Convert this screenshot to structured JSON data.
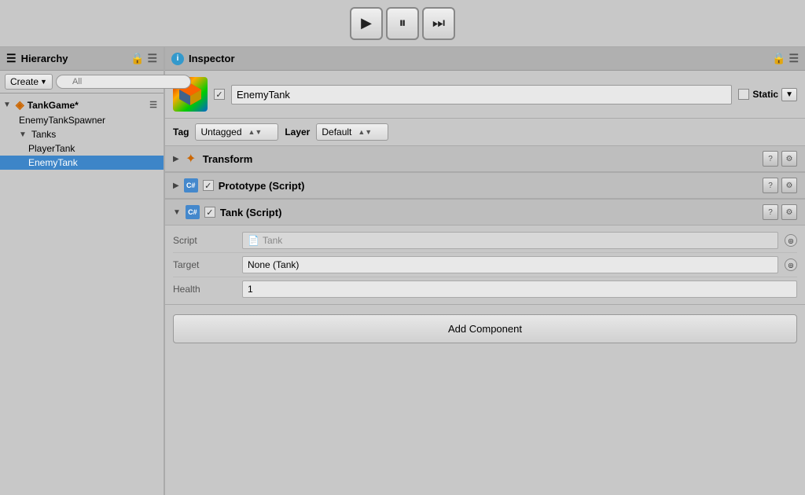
{
  "toolbar": {
    "play_label": "▶",
    "pause_label": "⏸",
    "step_label": "⏭"
  },
  "hierarchy": {
    "title": "Hierarchy",
    "create_label": "Create",
    "search_placeholder": "All",
    "items": [
      {
        "id": "tankgame",
        "label": "TankGame*",
        "level": "root",
        "has_arrow": true,
        "arrow": "▼",
        "has_unity_icon": true
      },
      {
        "id": "enemytankspawner",
        "label": "EnemyTankSpawner",
        "level": "level1",
        "has_arrow": false
      },
      {
        "id": "tanks",
        "label": "Tanks",
        "level": "level1",
        "has_arrow": true,
        "arrow": "▼"
      },
      {
        "id": "playertank",
        "label": "PlayerTank",
        "level": "level2",
        "has_arrow": false
      },
      {
        "id": "enemytank",
        "label": "EnemyTank",
        "level": "level2",
        "has_arrow": false,
        "selected": true
      }
    ]
  },
  "inspector": {
    "title": "Inspector",
    "gameobject": {
      "name": "EnemyTank",
      "is_active": true,
      "is_static": false,
      "static_label": "Static",
      "tag_label": "Tag",
      "tag_value": "Untagged",
      "layer_label": "Layer",
      "layer_value": "Default"
    },
    "components": [
      {
        "id": "transform",
        "title": "Transform",
        "type": "transform",
        "expanded": true
      },
      {
        "id": "prototype",
        "title": "Prototype (Script)",
        "type": "script",
        "checked": true,
        "expanded": true
      },
      {
        "id": "tank",
        "title": "Tank (Script)",
        "type": "script",
        "checked": true,
        "expanded": true,
        "fields": [
          {
            "label": "Script",
            "value": "Tank",
            "type": "script_ref",
            "has_circle": true
          },
          {
            "label": "Target",
            "value": "None (Tank)",
            "type": "ref",
            "has_circle": true
          },
          {
            "label": "Health",
            "value": "1",
            "type": "number"
          }
        ]
      }
    ],
    "add_component_label": "Add Component"
  }
}
